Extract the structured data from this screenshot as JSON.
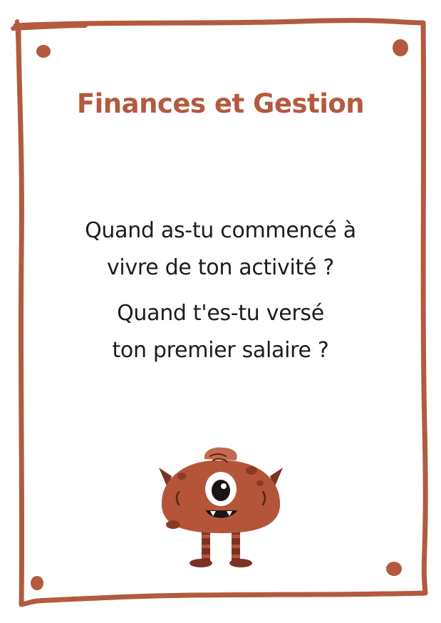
{
  "card": {
    "title": "Finances et Gestion",
    "question_1": {
      "line_1": "Quand as-tu commencé à",
      "line_2": "vivre de ton activité ?"
    },
    "question_2": {
      "line_1": "Quand t'es-tu versé",
      "line_2": "ton premier salaire ?"
    }
  },
  "illustration": {
    "name": "one-eyed-monster-icon"
  },
  "colors": {
    "accent": "#b35a3f",
    "monster_body": "#b4553a",
    "monster_dark": "#7a3322",
    "text": "#1c1c1c",
    "background": "#ffffff"
  }
}
